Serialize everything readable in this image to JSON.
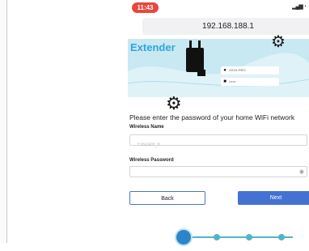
{
  "status": {
    "time": "11:43"
  },
  "browser": {
    "address": "192.168.188.1"
  },
  "hero": {
    "title": "Extender",
    "username_placeholder": "XXXX-PRO",
    "password_placeholder": "••••••"
  },
  "form": {
    "instruction": "Please enter the password of your home WiFi network",
    "wireless_name_label": "Wireless Name",
    "wireless_name_value": "Foscam_6",
    "wireless_password_label": "Wireless Password",
    "wireless_password_value": ""
  },
  "buttons": {
    "back": "Back",
    "next": "Next"
  },
  "stepper": {
    "current_step": 1,
    "total_steps": 4
  },
  "colors": {
    "accent": "#4472d3",
    "time_badge": "#e8473c",
    "hero_bg": "#c8e8f2",
    "step": "#4fb6c9"
  }
}
